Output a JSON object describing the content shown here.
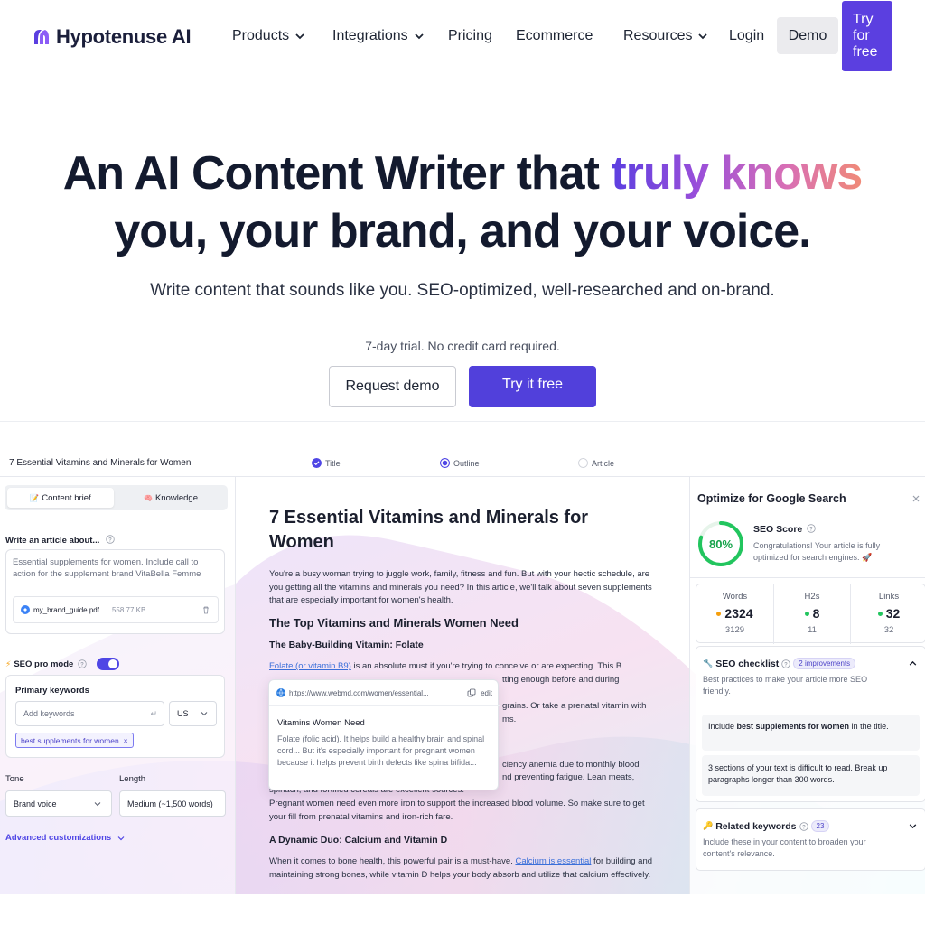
{
  "nav": {
    "brand": "Hypotenuse AI",
    "products": "Products",
    "integrations": "Integrations",
    "pricing": "Pricing",
    "ecommerce": "Ecommerce",
    "resources": "Resources",
    "login": "Login",
    "demo": "Demo",
    "try_line1": "Try",
    "try_line2": "for",
    "try_line3": "free"
  },
  "hero": {
    "title_a": "An AI Content Writer that ",
    "title_highlight": "truly knows",
    "title_b": "you, your brand, and your voice.",
    "subtitle": "Write content that sounds like you. SEO-optimized, well-researched and on-brand.",
    "trial_note": "7-day trial. No credit card required.",
    "request_demo": "Request demo",
    "try_free": "Try it free"
  },
  "app": {
    "doc_title": "7 Essential Vitamins and Minerals for Women",
    "steps": [
      "Title",
      "Outline",
      "Article"
    ],
    "left": {
      "tab_brief": "Content brief",
      "tab_knowledge": "Knowledge",
      "tab_brief_icon": "📝",
      "tab_knowledge_icon": "🧠",
      "write_label": "Write an article about...",
      "write_value": "Essential supplements for women. Include call to action for the supplement brand VitaBella Femme",
      "file_name": "my_brand_guide.pdf",
      "file_size": "558.77 KB",
      "seo_mode": "SEO pro mode",
      "primary_keywords": "Primary keywords",
      "keywords_placeholder": "Add keywords",
      "country": "US",
      "keyword_chip": "best supplements for women",
      "tone_label": "Tone",
      "tone_value": "Brand voice",
      "length_label": "Length",
      "length_value": "Medium (~1,500 words)",
      "advanced": "Advanced customizations"
    },
    "article": {
      "title": "7 Essential Vitamins and Minerals for Women",
      "intro": "You're a busy woman trying to juggle work, family, fitness and fun. But with your hectic schedule, are you getting all the vitamins and minerals you need? In this article, we'll talk about seven supplements that are especially important for women's health.",
      "h2": "The Top Vitamins and Minerals Women Need",
      "h3_folate": "The Baby-Building Vitamin: Folate",
      "folate_link": "Folate (or vitamin B9)",
      "folate_rest": " is an absolute must if you're trying to conceive or are expecting. This B",
      "folate_tail1": "tting enough before and during",
      "folate_tail2": "grains. Or take a prenatal vitamin with",
      "folate_tail3": "ms.",
      "iron_tail1": "ciency anemia due to monthly blood",
      "iron_tail2": "nd preventing fatigue. Lean meats,",
      "iron_line3": "spinach, and fortified cereals are excellent sources.",
      "iron_line4": "Pregnant women need even more iron to support the increased blood volume. So make sure to get your fill from prenatal vitamins and iron-rich fare.",
      "h3_calcium": "A Dynamic Duo: Calcium and Vitamin D",
      "calcium_a": "When it comes to bone health, this powerful pair is a must-have. ",
      "calcium_link": "Calcium is essential",
      "calcium_b": " for building and maintaining strong bones, while vitamin D helps your body absorb and utilize that calcium effectively."
    },
    "popup": {
      "url": "https://www.webmd.com/women/essential...",
      "edit": "edit",
      "title": "Vitamins Women Need",
      "body": "Folate (folic acid). It helps build a healthy brain and spinal cord... But it's especially important for pregnant women because it helps prevent birth defects like spina bifida..."
    },
    "right": {
      "title": "Optimize for Google Search",
      "score_percent": 80,
      "score_text": "80%",
      "score_label": "SEO Score",
      "score_msg": "Congratulations! Your article is fully optimized for search engines. 🚀",
      "stats": [
        {
          "label": "Words",
          "value": "2324",
          "target": "3129",
          "color": "#f59e0b"
        },
        {
          "label": "H2s",
          "value": "8",
          "target": "11",
          "color": "#22c55e"
        },
        {
          "label": "Links",
          "value": "32",
          "target": "32",
          "color": "#22c55e"
        }
      ],
      "checklist_title": "SEO checklist",
      "checklist_badge": "2 improvements",
      "checklist_desc": "Best practices to make your article more SEO friendly.",
      "item1_a": "Include ",
      "item1_b": "best supplements for women",
      "item1_c": " in the title.",
      "item2": "3 sections of your text is difficult to read. Break up paragraphs longer than 300 words.",
      "related_title": "Related keywords",
      "related_badge": "23",
      "related_desc": "Include these in your content to broaden your content's relevance."
    }
  }
}
